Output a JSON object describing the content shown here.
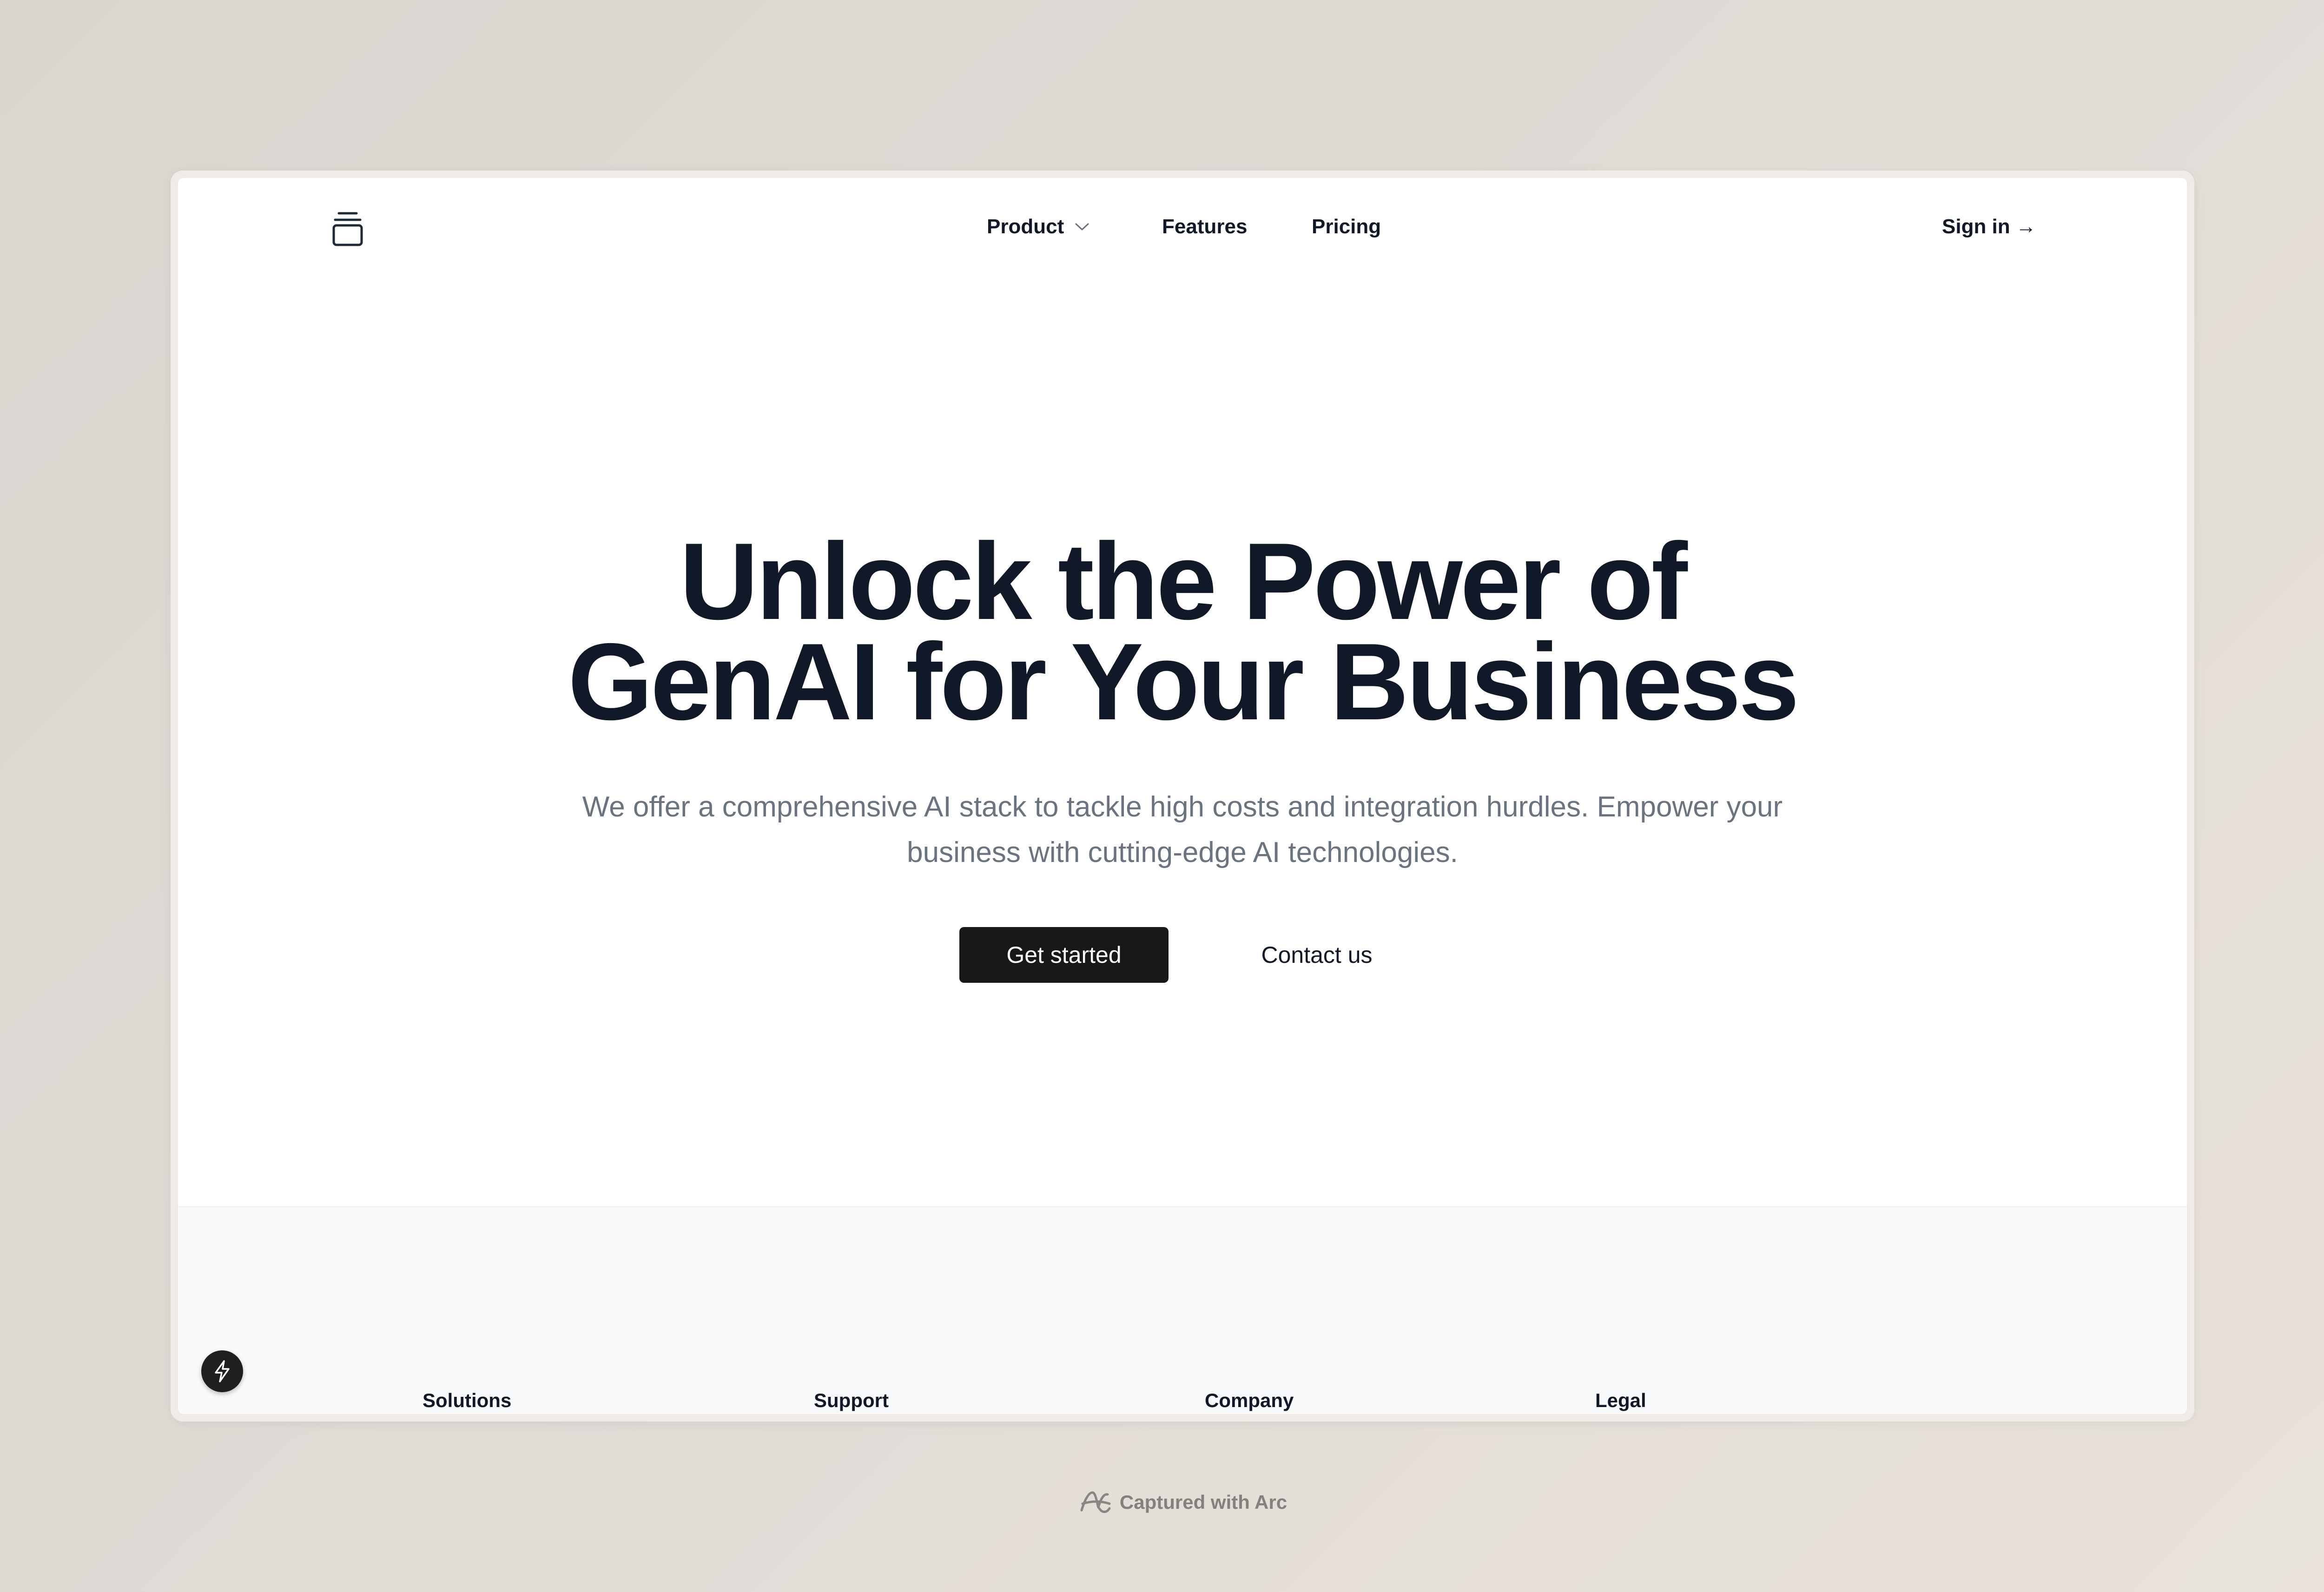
{
  "nav": {
    "logo_icon": "stacked-boxes-icon",
    "items": [
      {
        "label": "Product",
        "has_dropdown": true
      },
      {
        "label": "Features"
      },
      {
        "label": "Pricing"
      }
    ],
    "signin_label": "Sign in →"
  },
  "hero": {
    "title_line1": "Unlock the Power of",
    "title_line2": "GenAI for Your Business",
    "subtitle": "We offer a comprehensive AI stack to tackle high costs and integration hurdles. Empower your business with cutting-edge AI technologies.",
    "primary_button": "Get started",
    "secondary_button": "Contact us"
  },
  "footer": {
    "columns": [
      "Solutions",
      "Support",
      "Company",
      "Legal"
    ]
  },
  "floating_button_icon": "lightning-bolt-icon",
  "caption": {
    "icon": "arc-logo-icon",
    "text": "Captured with Arc"
  },
  "colors": {
    "primary_button_bg": "#18181b",
    "heading_text": "#111827",
    "subtitle_text": "#6b7280",
    "footer_bg": "#f8fafc"
  }
}
